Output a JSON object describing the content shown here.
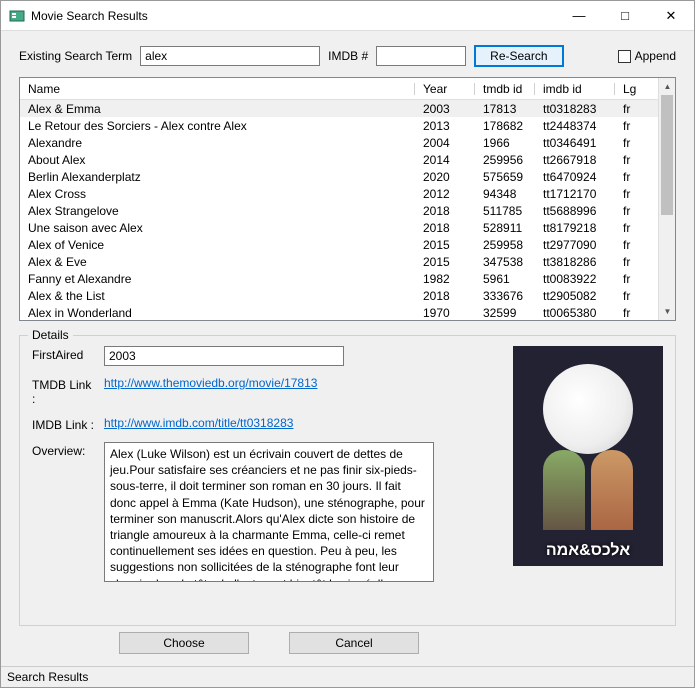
{
  "window": {
    "title": "Movie Search Results"
  },
  "search": {
    "existing_label": "Existing Search Term",
    "existing_value": "alex",
    "imdb_label": "IMDB #",
    "imdb_value": "",
    "research_btn": "Re-Search",
    "append_label": "Append"
  },
  "table": {
    "headers": {
      "name": "Name",
      "year": "Year",
      "tmdb": "tmdb id",
      "imdb": "imdb id",
      "lg": "Lg"
    },
    "rows": [
      {
        "name": "Alex & Emma",
        "year": "2003",
        "tmdb": "17813",
        "imdb": "tt0318283",
        "lg": "fr"
      },
      {
        "name": "Le Retour des Sorciers - Alex contre Alex",
        "year": "2013",
        "tmdb": "178682",
        "imdb": "tt2448374",
        "lg": "fr"
      },
      {
        "name": "Alexandre",
        "year": "2004",
        "tmdb": "1966",
        "imdb": "tt0346491",
        "lg": "fr"
      },
      {
        "name": "About Alex",
        "year": "2014",
        "tmdb": "259956",
        "imdb": "tt2667918",
        "lg": "fr"
      },
      {
        "name": "Berlin Alexanderplatz",
        "year": "2020",
        "tmdb": "575659",
        "imdb": "tt6470924",
        "lg": "fr"
      },
      {
        "name": "Alex Cross",
        "year": "2012",
        "tmdb": "94348",
        "imdb": "tt1712170",
        "lg": "fr"
      },
      {
        "name": "Alex Strangelove",
        "year": "2018",
        "tmdb": "511785",
        "imdb": "tt5688996",
        "lg": "fr"
      },
      {
        "name": "Une saison avec Alex",
        "year": "2018",
        "tmdb": "528911",
        "imdb": "tt8179218",
        "lg": "fr"
      },
      {
        "name": "Alex of Venice",
        "year": "2015",
        "tmdb": "259958",
        "imdb": "tt2977090",
        "lg": "fr"
      },
      {
        "name": "Alex & Eve",
        "year": "2015",
        "tmdb": "347538",
        "imdb": "tt3818286",
        "lg": "fr"
      },
      {
        "name": "Fanny et Alexandre",
        "year": "1982",
        "tmdb": "5961",
        "imdb": "tt0083922",
        "lg": "fr"
      },
      {
        "name": "Alex & the List",
        "year": "2018",
        "tmdb": "333676",
        "imdb": "tt2905082",
        "lg": "fr"
      },
      {
        "name": "Alex in Wonderland",
        "year": "1970",
        "tmdb": "32599",
        "imdb": "tt0065380",
        "lg": "fr"
      }
    ]
  },
  "details": {
    "group_label": "Details",
    "first_aired_label": "FirstAired",
    "first_aired_value": "2003",
    "tmdb_link_label": "TMDB Link :",
    "tmdb_link_value": "http://www.themoviedb.org/movie/17813",
    "imdb_link_label": "IMDB Link :",
    "imdb_link_value": "http://www.imdb.com/title/tt0318283",
    "overview_label": "Overview:",
    "overview_text": "Alex (Luke Wilson) est un écrivain couvert de dettes de jeu.Pour satisfaire ses créanciers et ne pas finir six-pieds-sous-terre, il doit terminer son roman en 30 jours. Il fait donc appel à Emma (Kate Hudson), une sténographe, pour terminer son manuscrit.Alors qu'Alex dicte son histoire de triangle amoureux à la charmante Emma, celle-ci remet continuellement ses idées en question. Peu à peu, les suggestions non sollicitées de la sténographe font leur chemin dans la tête de l'auteur et bientôt la vie réelle commence à imiter le roman...",
    "poster_caption": "אלכס&אמה"
  },
  "buttons": {
    "choose": "Choose",
    "cancel": "Cancel"
  },
  "statusbar": "Search Results"
}
